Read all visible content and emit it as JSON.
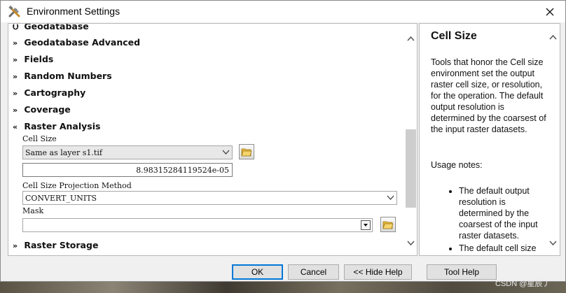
{
  "window": {
    "title": "Environment Settings",
    "icon": "tools-icon",
    "close_icon": "close-icon"
  },
  "settings": {
    "sections_above": [
      {
        "label": "Geodatabase",
        "icon": "chevron-double-down-icon"
      },
      {
        "label": "Geodatabase Advanced",
        "icon": "chevron-double-down-icon"
      },
      {
        "label": "Fields",
        "icon": "chevron-double-down-icon"
      },
      {
        "label": "Random Numbers",
        "icon": "chevron-double-down-icon"
      },
      {
        "label": "Cartography",
        "icon": "chevron-double-down-icon"
      },
      {
        "label": "Coverage",
        "icon": "chevron-double-down-icon"
      }
    ],
    "expanded_section": {
      "label": "Raster Analysis",
      "icon": "chevron-double-up-icon",
      "cell_size": {
        "label": "Cell Size",
        "selected": "Same as layer s1.tif",
        "value": "8.98315284119524e-05"
      },
      "projection_method": {
        "label": "Cell Size Projection Method",
        "selected": "CONVERT_UNITS"
      },
      "mask": {
        "label": "Mask",
        "value": ""
      }
    },
    "sections_below": [
      {
        "label": "Raster Storage",
        "icon": "chevron-double-down-icon"
      }
    ]
  },
  "help": {
    "title": "Cell Size",
    "intro": "Tools that honor the Cell size environment set the output raster cell size, or resolution, for the operation. The default output resolution is determined by the coarsest of the input raster datasets.",
    "usage_heading": "Usage notes:",
    "notes": [
      "The default output resolution is determined by the coarsest of the input raster datasets.",
      "The default cell size"
    ]
  },
  "buttons": {
    "ok": "OK",
    "cancel": "Cancel",
    "hide_help": "<< Hide Help",
    "tool_help": "Tool Help"
  },
  "watermark": "CSDN @星辰丿"
}
